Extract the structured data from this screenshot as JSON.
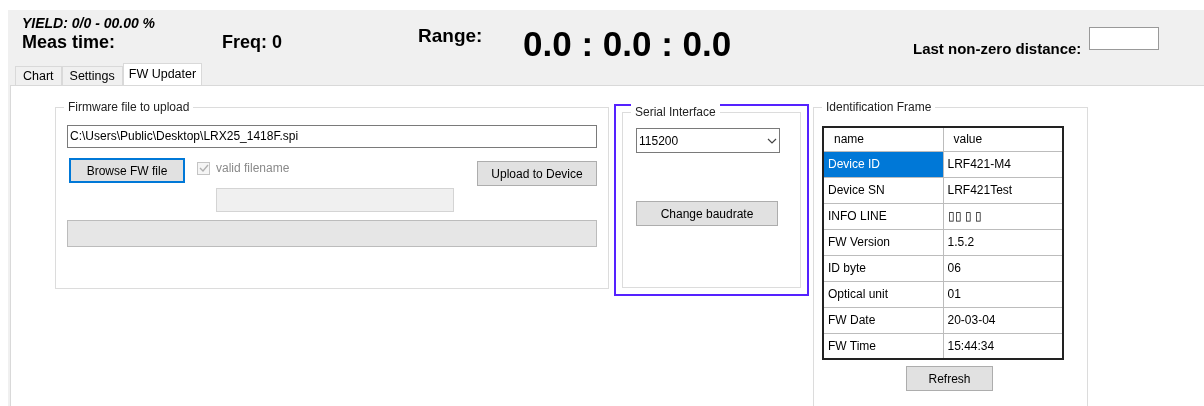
{
  "header": {
    "yield": "YIELD: 0/0 - 00.00 %",
    "meas_time_label": "Meas time:",
    "freq": "Freq: 0",
    "range_label": "Range:",
    "range_value": "0.0 : 0.0 : 0.0",
    "last_distance_label": "Last non-zero distance:"
  },
  "tabs": [
    {
      "label": "Chart",
      "selected": false
    },
    {
      "label": "Settings",
      "selected": false
    },
    {
      "label": "FW Updater",
      "selected": true
    }
  ],
  "firmware": {
    "title": "Firmware file to upload",
    "path": "C:\\Users\\Public\\Desktop\\LRX25_1418F.spi",
    "browse_button": "Browse FW file",
    "valid": {
      "label": "valid filename",
      "checked": true,
      "disabled": true
    },
    "upload_button": "Upload to Device",
    "progress": {
      "level": 0
    }
  },
  "serial": {
    "title": "Serial Interface",
    "baudrate": "115200",
    "change_button": "Change baudrate"
  },
  "identification": {
    "title": "Identification Frame",
    "columns": [
      "name",
      "value"
    ],
    "rows": [
      {
        "name": "Device ID",
        "value": "LRF421-M4",
        "selected": true
      },
      {
        "name": "Device SN",
        "value": "LRF421Test",
        "selected": false
      },
      {
        "name": "INFO LINE",
        "value": "▯▯ ▯ ▯",
        "selected": false
      },
      {
        "name": "FW Version",
        "value": "1.5.2",
        "selected": false
      },
      {
        "name": "ID byte",
        "value": "06",
        "selected": false
      },
      {
        "name": "Optical unit",
        "value": "01",
        "selected": false
      },
      {
        "name": "FW Date",
        "value": "20-03-04",
        "selected": false
      },
      {
        "name": "FW Time",
        "value": "15:44:34",
        "selected": false
      }
    ],
    "refresh_button": "Refresh"
  }
}
